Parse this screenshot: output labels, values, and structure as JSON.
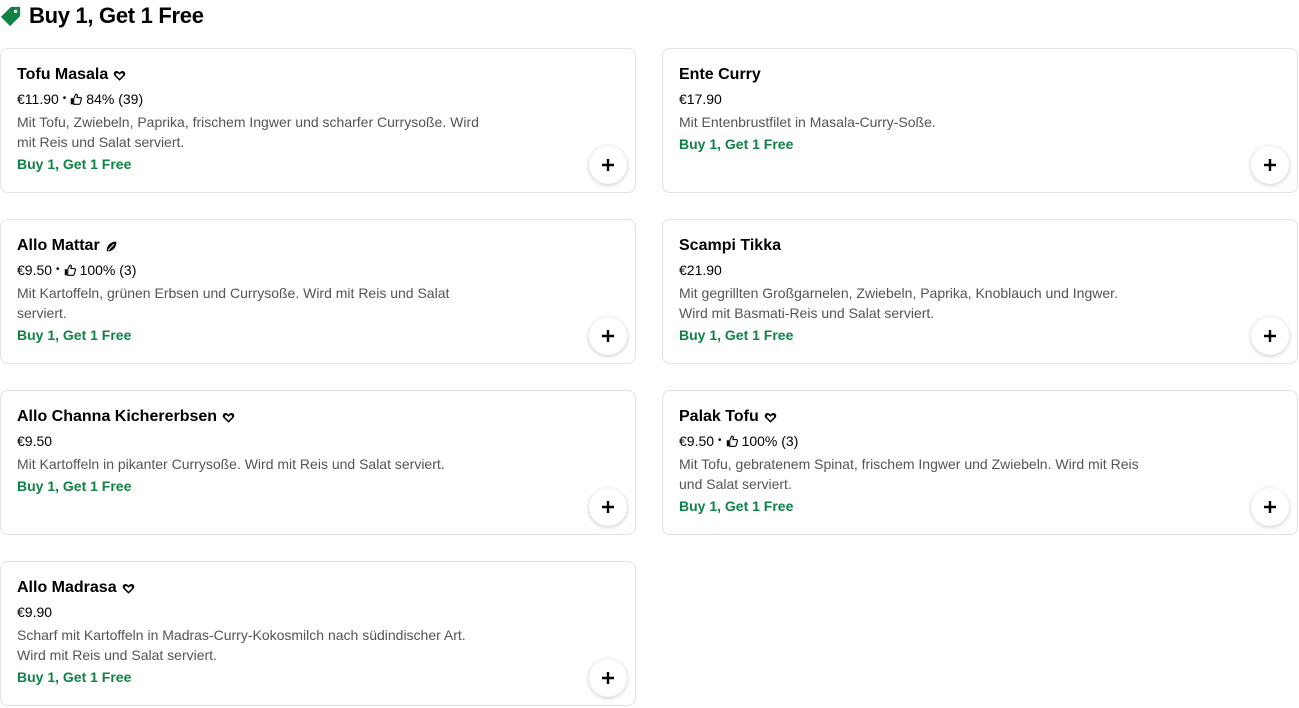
{
  "section": {
    "title": "Buy 1, Get 1 Free",
    "icon": "price-tag-icon",
    "accent": "#0e8345"
  },
  "items": [
    {
      "name": "Tofu Masala",
      "badge": "heart-icon",
      "price": "€11.90",
      "rating": "84% (39)",
      "description": "Mit Tofu, Zwiebeln, Paprika, frischem Ingwer und scharfer Currysoße. Wird mit Reis und Salat serviert.",
      "promo": "Buy 1, Get 1 Free"
    },
    {
      "name": "Ente Curry",
      "badge": null,
      "price": "€17.90",
      "rating": null,
      "description": "Mit Entenbrustfilet in Masala-Curry-Soße.",
      "promo": "Buy 1, Get 1 Free"
    },
    {
      "name": "Allo Mattar",
      "badge": "leaf-icon",
      "price": "€9.50",
      "rating": "100% (3)",
      "description": "Mit Kartoffeln, grünen Erbsen und Currysoße. Wird mit Reis und Salat serviert.",
      "promo": "Buy 1, Get 1 Free"
    },
    {
      "name": "Scampi Tikka",
      "badge": null,
      "price": "€21.90",
      "rating": null,
      "description": "Mit gegrillten Großgarnelen, Zwiebeln, Paprika, Knoblauch und Ingwer. Wird mit Basmati-Reis und Salat serviert.",
      "promo": "Buy 1, Get 1 Free"
    },
    {
      "name": "Allo Channa Kichererbsen",
      "badge": "heart-icon",
      "price": "€9.50",
      "rating": null,
      "description": "Mit Kartoffeln in pikanter Currysoße. Wird mit Reis und Salat serviert.",
      "promo": "Buy 1, Get 1 Free"
    },
    {
      "name": "Palak Tofu",
      "badge": "heart-icon",
      "price": "€9.50",
      "rating": "100% (3)",
      "description": "Mit Tofu, gebratenem Spinat, frischem Ingwer und Zwiebeln. Wird mit Reis und Salat serviert.",
      "promo": "Buy 1, Get 1 Free"
    },
    {
      "name": "Allo Madrasa",
      "badge": "heart-icon",
      "price": "€9.90",
      "rating": null,
      "description": "Scharf mit Kartoffeln in Madras-Curry-Kokosmilch nach südindischer Art. Wird mit Reis und Salat serviert.",
      "promo": "Buy 1, Get 1 Free"
    }
  ],
  "add_button_icon": "plus-icon"
}
